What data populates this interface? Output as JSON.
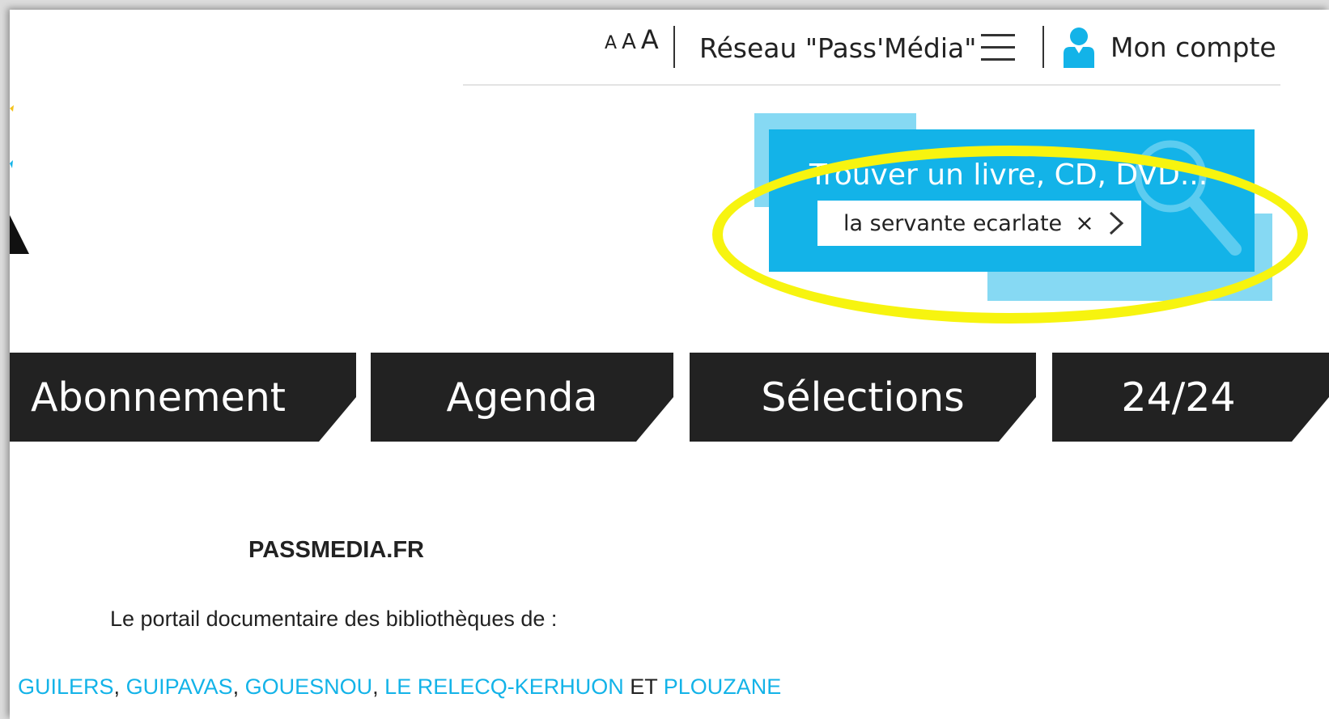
{
  "header": {
    "font_size_controls": [
      "A",
      "A",
      "A"
    ],
    "network_label": "Réseau \"Pass'Média\"",
    "menu_icon": "hamburger-icon",
    "account_icon": "user-icon",
    "account_label": "Mon compte"
  },
  "search": {
    "title": "Trouver un livre, CD, DVD...",
    "query": "la servante ecarlate",
    "clear_label": "×",
    "submit_icon": "chevron-right-icon",
    "background_icon": "magnifier-icon"
  },
  "nav": {
    "tabs": [
      {
        "label": "Abonnement"
      },
      {
        "label": "Agenda"
      },
      {
        "label": "Sélections"
      },
      {
        "label": "24/24"
      }
    ]
  },
  "content": {
    "site_title": "PASSMEDIA.FR",
    "portal_description": "Le portail documentaire des bibliothèques de :",
    "towns": [
      "GUILERS",
      "GUIPAVAS",
      "GOUESNOU",
      "LE RELECQ-KERHUON",
      "PLOUZANE"
    ],
    "separator": ", ",
    "conjunction": " ET "
  },
  "colors": {
    "accent": "#13b3e8",
    "accent_light": "#86d9f3",
    "nav_bg": "#222222",
    "highlight": "#f7f40f"
  }
}
